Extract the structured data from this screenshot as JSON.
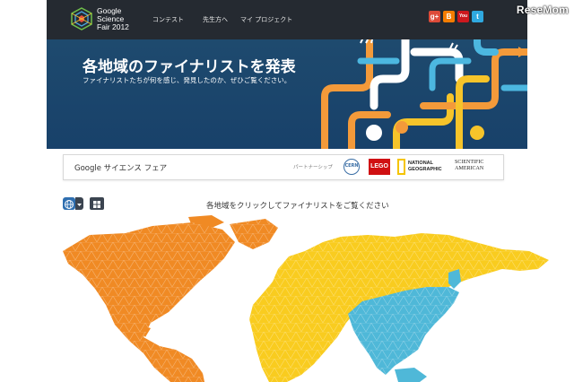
{
  "header": {
    "logo_line1": "Google",
    "logo_line2": "Science",
    "logo_line3": "Fair 2012",
    "nav": [
      {
        "label": "コンテスト"
      },
      {
        "label": "先生方へ"
      },
      {
        "label": "マイ プロジェクト"
      }
    ],
    "social": [
      {
        "icon": "google-plus-icon",
        "label": "g+",
        "color": "#dd4b39"
      },
      {
        "icon": "blogger-icon",
        "label": "B",
        "color": "#f57d00"
      },
      {
        "icon": "youtube-icon",
        "label": "You",
        "color": "#cc181e"
      },
      {
        "icon": "twitter-icon",
        "label": "t",
        "color": "#2fa9e0"
      }
    ],
    "watermark": "ReseMom"
  },
  "hero": {
    "title": "各地域のファイナリストを発表",
    "subtitle": "ファイナリストたちが何を感じ、発見したのか、ぜひご覧ください。"
  },
  "partners": {
    "title": "Google サイエンス フェア",
    "label": "パートナーシップ",
    "cern": "CERN",
    "lego": "LEGO",
    "natgeo_line1": "NATIONAL",
    "natgeo_line2": "GEOGRAPHIC",
    "sciam_line1": "SCIENTIFIC",
    "sciam_line2": "AMERICAN"
  },
  "map": {
    "title": "各地域をクリックしてファイナリストをご覧ください",
    "regions": [
      {
        "name": "americas",
        "color": "#f08a24"
      },
      {
        "name": "europe-africa",
        "color": "#f9cc1f"
      },
      {
        "name": "asia-pacific",
        "color": "#4fb8d8"
      }
    ]
  },
  "colors": {
    "header_bg": "#252a31",
    "hero_bg": "#1b456b",
    "orange": "#f08a24",
    "yellow": "#f9cc1f",
    "blue": "#4fb8d8"
  }
}
